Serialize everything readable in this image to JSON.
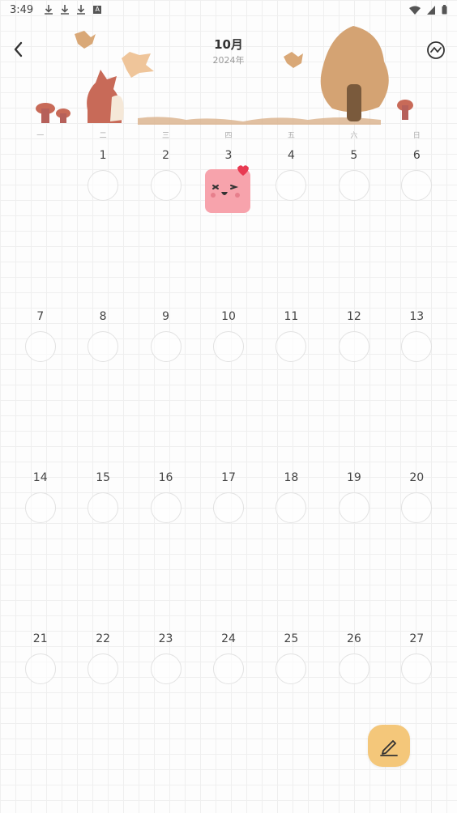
{
  "status_bar": {
    "time": "3:49",
    "a_label": "A"
  },
  "header": {
    "month": "10月",
    "year": "2024年"
  },
  "weekdays": [
    "一",
    "二",
    "三",
    "四",
    "五",
    "六",
    "日"
  ],
  "weeks": [
    [
      null,
      "1",
      "2",
      "3",
      "4",
      "5",
      "6"
    ],
    [
      "7",
      "8",
      "9",
      "10",
      "11",
      "12",
      "13"
    ],
    [
      "14",
      "15",
      "16",
      "17",
      "18",
      "19",
      "20"
    ],
    [
      "21",
      "22",
      "23",
      "24",
      "25",
      "26",
      "27"
    ]
  ],
  "mood_entries": {
    "3": "happy-face-sticker"
  },
  "colors": {
    "accent_fab": "#f4c77a",
    "sticker_pink": "#f7a3ac",
    "heart_red": "#e83a52",
    "tree_brown": "#d4a373"
  }
}
